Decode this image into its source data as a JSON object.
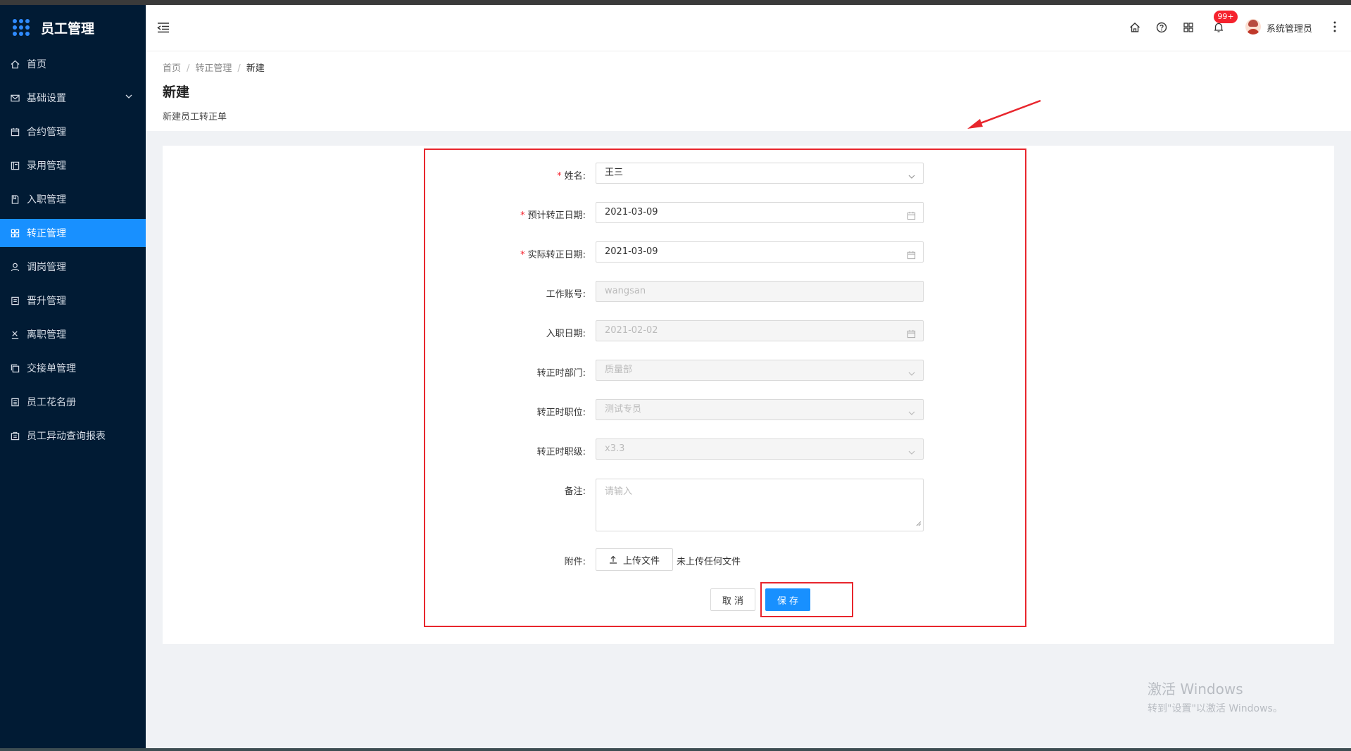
{
  "app": {
    "title": "员工管理"
  },
  "sidebar": {
    "items": [
      {
        "label": "首页",
        "icon": "home-icon"
      },
      {
        "label": "基础设置",
        "icon": "mail-icon",
        "has_submenu": true
      },
      {
        "label": "合约管理",
        "icon": "calendar-icon"
      },
      {
        "label": "录用管理",
        "icon": "book-icon"
      },
      {
        "label": "入职管理",
        "icon": "document-icon"
      },
      {
        "label": "转正管理",
        "icon": "grid-icon",
        "active": true
      },
      {
        "label": "调岗管理",
        "icon": "user-icon"
      },
      {
        "label": "晋升管理",
        "icon": "file-icon"
      },
      {
        "label": "离职管理",
        "icon": "exit-icon"
      },
      {
        "label": "交接单管理",
        "icon": "copy-icon"
      },
      {
        "label": "员工花名册",
        "icon": "list-icon"
      },
      {
        "label": "员工异动查询报表",
        "icon": "report-icon"
      }
    ]
  },
  "header": {
    "notification_count": "99+",
    "username": "系统管理员"
  },
  "breadcrumb": {
    "home": "首页",
    "section": "转正管理",
    "current": "新建"
  },
  "page": {
    "title": "新建",
    "subtitle": "新建员工转正单"
  },
  "form": {
    "name": {
      "label": "姓名:",
      "value": "王三",
      "required": true
    },
    "expected_date": {
      "label": "预计转正日期:",
      "value": "2021-03-09",
      "required": true
    },
    "actual_date": {
      "label": "实际转正日期:",
      "value": "2021-03-09",
      "required": true
    },
    "account": {
      "label": "工作账号:",
      "value": "wangsan"
    },
    "hire_date": {
      "label": "入职日期:",
      "value": "2021-02-02"
    },
    "department": {
      "label": "转正时部门:",
      "value": "质量部"
    },
    "position": {
      "label": "转正时职位:",
      "value": "测试专员"
    },
    "level": {
      "label": "转正时职级:",
      "value": "x3.3"
    },
    "remark": {
      "label": "备注:",
      "placeholder": "请输入"
    },
    "attachment": {
      "label": "附件:",
      "button": "上传文件",
      "hint": "未上传任何文件"
    },
    "cancel": "取 消",
    "save": "保 存"
  },
  "watermark": {
    "line1": "激活 Windows",
    "line2": "转到\"设置\"以激活 Windows。"
  },
  "colors": {
    "sidebar_bg": "#011b34",
    "accent": "#1890ff",
    "highlight": "#e8262d"
  }
}
